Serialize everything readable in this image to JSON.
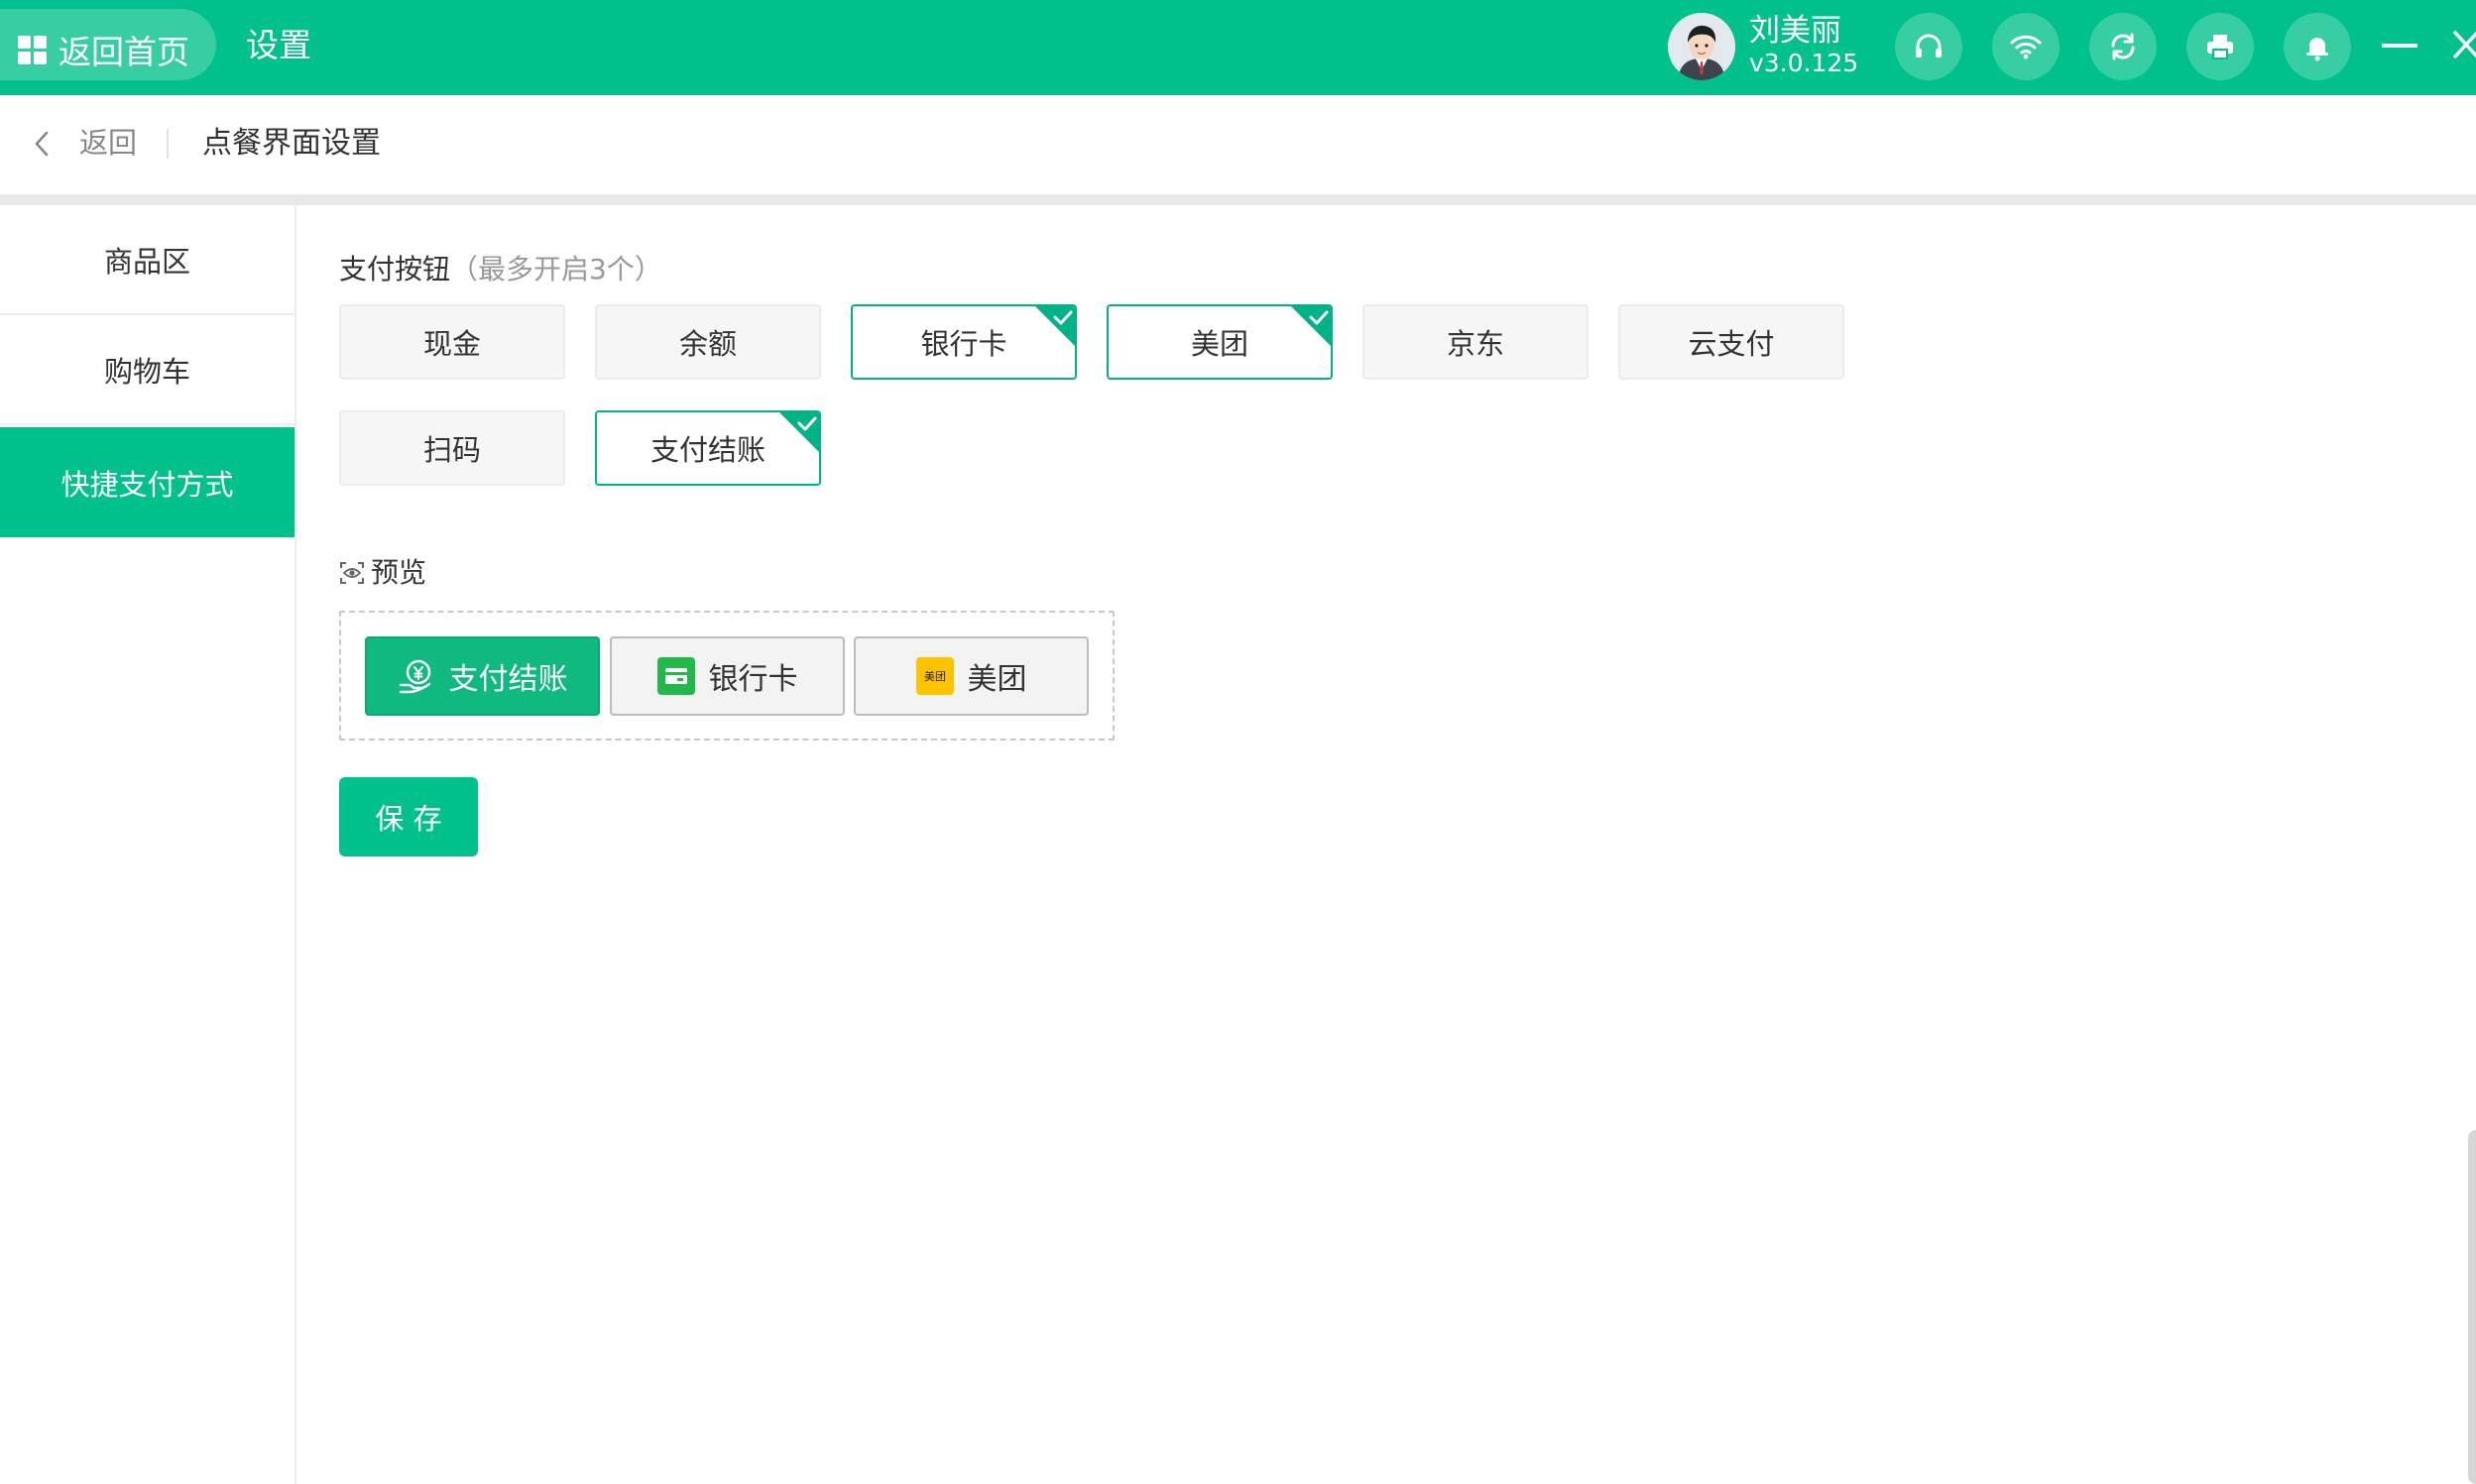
{
  "header": {
    "home_label": "返回首页",
    "title": "设置",
    "user_name": "刘美丽",
    "version": "v3.0.125",
    "brand_color": "#00c08b",
    "icons": [
      "headset-icon",
      "wifi-icon",
      "refresh-icon",
      "printer-icon",
      "bell-icon",
      "minimize-icon",
      "close-icon"
    ]
  },
  "breadcrumb": {
    "back_label": "返回",
    "title": "点餐界面设置"
  },
  "sidebar": {
    "items": [
      {
        "label": "商品区",
        "active": false
      },
      {
        "label": "购物车",
        "active": false
      },
      {
        "label": "快捷支付方式",
        "active": true
      }
    ]
  },
  "payment": {
    "section_label": "支付按钮",
    "section_hint": "（最多开启3个）",
    "options": [
      {
        "label": "现金",
        "selected": false
      },
      {
        "label": "余额",
        "selected": false
      },
      {
        "label": "银行卡",
        "selected": true
      },
      {
        "label": "美团",
        "selected": true
      },
      {
        "label": "京东",
        "selected": false
      },
      {
        "label": "云支付",
        "selected": false
      },
      {
        "label": "扫码",
        "selected": false
      },
      {
        "label": "支付结账",
        "selected": true
      }
    ]
  },
  "preview": {
    "label": "预览",
    "buttons": [
      {
        "label": "支付结账",
        "icon": "coin-hand-icon"
      },
      {
        "label": "银行卡",
        "icon": "bank-card-icon"
      },
      {
        "label": "美团",
        "icon": "meituan-logo-icon",
        "icon_text": "美团"
      }
    ]
  },
  "actions": {
    "save_label": "保 存"
  }
}
